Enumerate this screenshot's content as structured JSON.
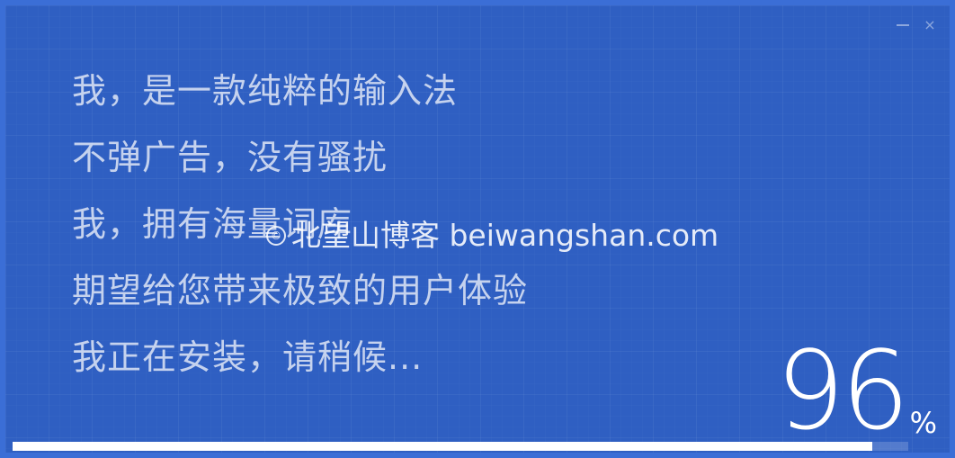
{
  "window": {
    "minimize_icon": "minimize-icon",
    "close_icon": "close-icon",
    "close_label": "×"
  },
  "intro_lines": [
    "我，是一款纯粹的输入法",
    "不弹广告，没有骚扰",
    "我，拥有海量词库",
    "期望给您带来极致的用户体验",
    "我正在安装，请稍候..."
  ],
  "watermark": {
    "symbol": "©",
    "text": "北望山博客 beiwangshan.com"
  },
  "progress": {
    "value": "96",
    "unit": "%",
    "fraction": 0.96
  },
  "colors": {
    "background": "#2f5fc2",
    "text": "#ffffff",
    "progress_fill": "#ffffff"
  }
}
